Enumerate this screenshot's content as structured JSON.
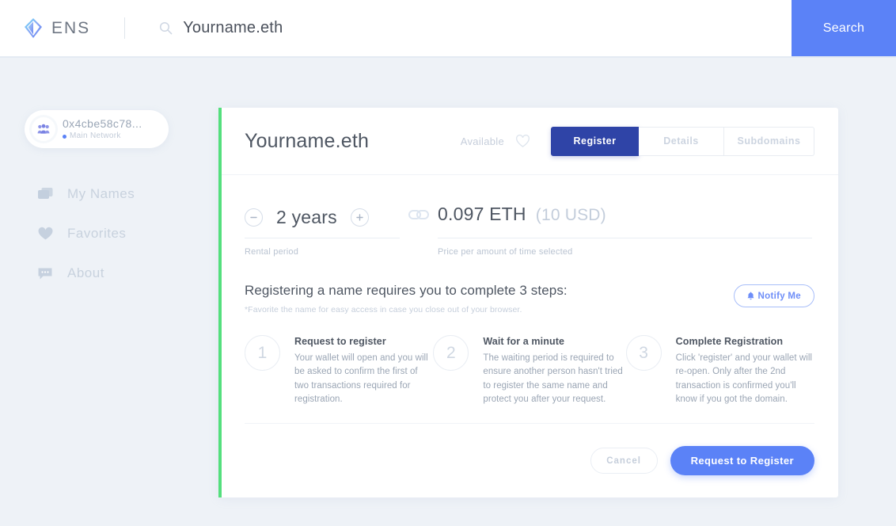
{
  "brand": {
    "name": "ENS",
    "logo_icon": "ens-diamond-logo"
  },
  "search": {
    "icon": "search-icon",
    "value": "Yourname.eth",
    "placeholder": "Search for a name",
    "button_label": "Search"
  },
  "account": {
    "avatar_icon": "group-avatar-icon",
    "address": "0x4cbe58c78...",
    "network": "Main Network",
    "network_dot_color": "#5b82f7"
  },
  "sidebar": {
    "items": [
      {
        "label": "My Names",
        "icon": "cards-icon"
      },
      {
        "label": "Favorites",
        "icon": "heart-icon"
      },
      {
        "label": "About",
        "icon": "chat-bubble-icon"
      }
    ]
  },
  "card": {
    "accent_color": "#54df7d",
    "header": {
      "domain": "Yourname.eth",
      "availability": "Available",
      "favorite_icon": "heart-outline-icon",
      "tabs": [
        {
          "label": "Register",
          "active": true
        },
        {
          "label": "Details",
          "active": false
        },
        {
          "label": "Subdomains",
          "active": false
        }
      ]
    },
    "rental": {
      "decrement_icon": "minus-circle-icon",
      "increment_icon": "plus-circle-icon",
      "value": "2 years",
      "label": "Rental period"
    },
    "link_icon": "chain-link-icon",
    "price": {
      "eth": "0.097 ETH",
      "usd": "(10 USD)",
      "label": "Price per amount of time selected"
    },
    "steps_intro": {
      "title": "Registering a name requires you to complete 3 steps:",
      "note": "*Favorite the name for easy access in case you close out of your browser.",
      "notify_label": "Notify Me",
      "notify_icon": "bell-icon"
    },
    "steps": [
      {
        "number": "1",
        "title": "Request to register",
        "description": "Your wallet will open and you will be asked to confirm the first of two transactions required for registration."
      },
      {
        "number": "2",
        "title": "Wait for a minute",
        "description": "The waiting period is required to ensure another person hasn't tried to register the same name and protect you after your request."
      },
      {
        "number": "3",
        "title": "Complete Registration",
        "description": "Click 'register' and your wallet will re-open. Only after the 2nd transaction is confirmed you'll know if you got the domain."
      }
    ],
    "footer": {
      "cancel_label": "Cancel",
      "primary_label": "Request to Register",
      "primary_color": "#5b82f7"
    }
  }
}
